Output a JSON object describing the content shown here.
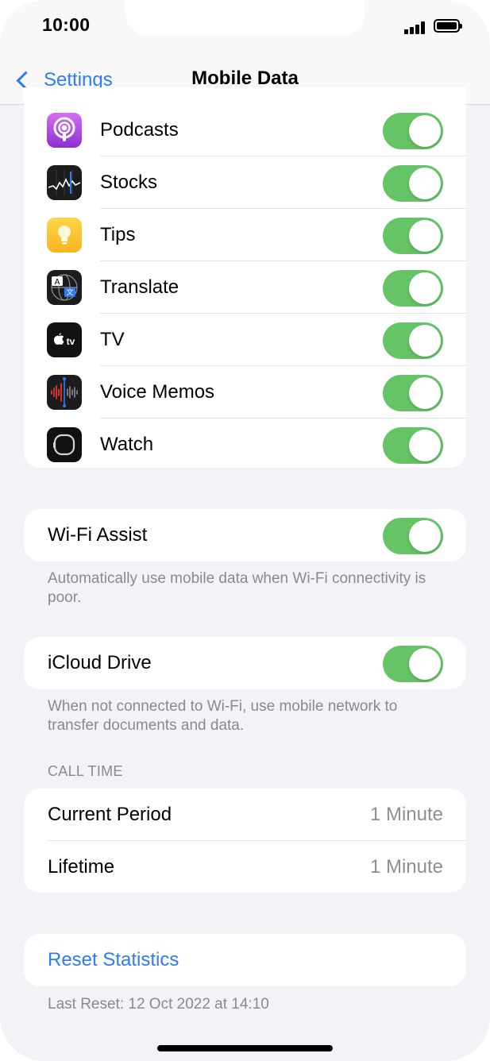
{
  "status": {
    "time": "10:00"
  },
  "nav": {
    "back_label": "Settings",
    "title": "Mobile Data"
  },
  "apps": [
    {
      "name": "Podcasts",
      "icon": "podcasts-icon",
      "enabled": true
    },
    {
      "name": "Stocks",
      "icon": "stocks-icon",
      "enabled": true
    },
    {
      "name": "Tips",
      "icon": "tips-icon",
      "enabled": true
    },
    {
      "name": "Translate",
      "icon": "translate-icon",
      "enabled": true
    },
    {
      "name": "TV",
      "icon": "tv-icon",
      "enabled": true
    },
    {
      "name": "Voice Memos",
      "icon": "voice-memos-icon",
      "enabled": true
    },
    {
      "name": "Watch",
      "icon": "watch-icon",
      "enabled": true
    }
  ],
  "wifi_assist": {
    "label": "Wi-Fi Assist",
    "enabled": true,
    "footnote": "Automatically use mobile data when Wi-Fi connectivity is poor."
  },
  "icloud_drive": {
    "label": "iCloud Drive",
    "enabled": true,
    "footnote": "When not connected to Wi-Fi, use mobile network to transfer documents and data."
  },
  "call_time": {
    "header": "CALL TIME",
    "rows": [
      {
        "label": "Current Period",
        "value": "1 Minute"
      },
      {
        "label": "Lifetime",
        "value": "1 Minute"
      }
    ]
  },
  "reset": {
    "label": "Reset Statistics",
    "last_reset": "Last Reset: 12 Oct 2022 at 14:10"
  },
  "colors": {
    "accent": "#2f7bf5",
    "toggle_on": "#65c466",
    "background": "#f2f2f7"
  }
}
